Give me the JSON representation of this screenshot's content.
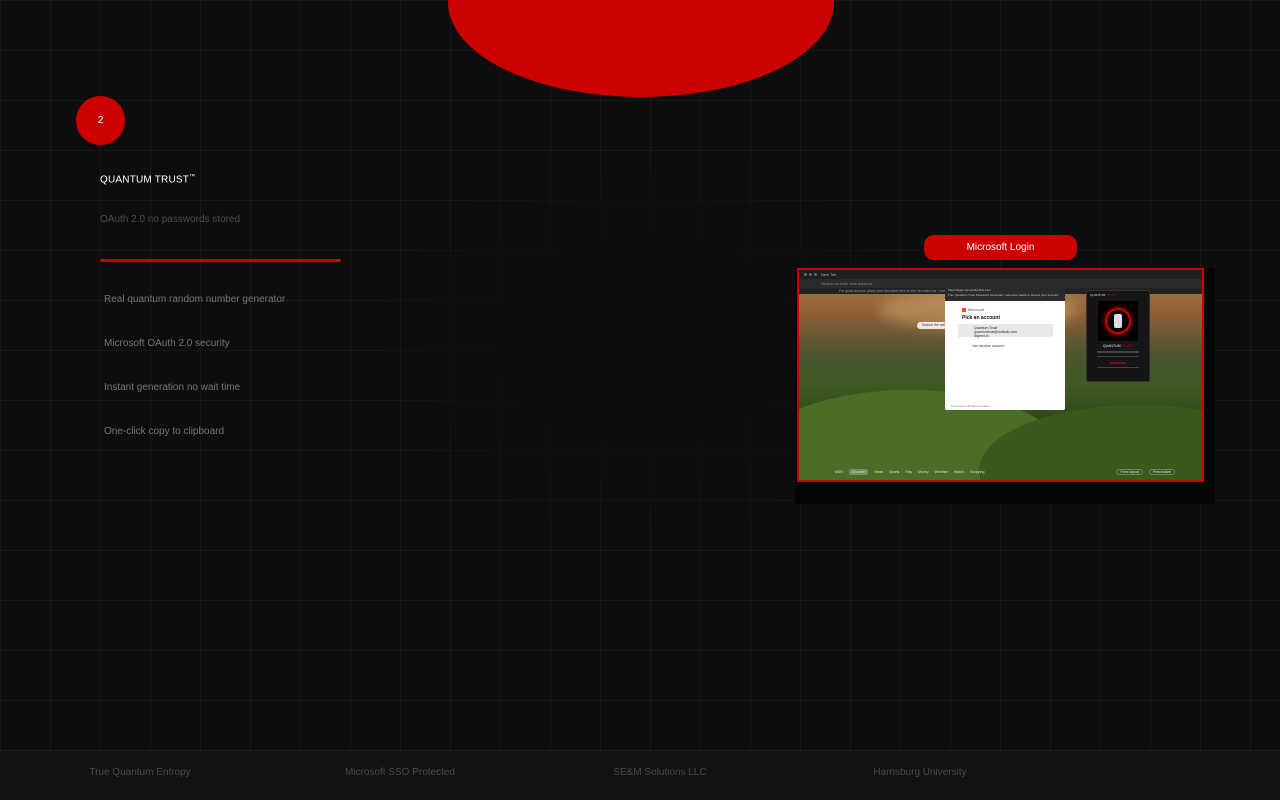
{
  "step": {
    "number": "2"
  },
  "brand": {
    "name": "QUANTUM TRUST",
    "trademark": "™"
  },
  "subtitle": "OAuth 2.0  no passwords stored",
  "features": [
    {
      "glyph": "",
      "text": "Real quantum random number generator"
    },
    {
      "glyph": "",
      "text": "Microsoft OAuth 2.0 security"
    },
    {
      "glyph": "",
      "text": "Instant generation  no wait time"
    },
    {
      "glyph": "",
      "text": "One-click copy to clipboard"
    }
  ],
  "preview": {
    "label": "Microsoft Login",
    "tab_title": "New Tab",
    "url_placeholder": "Search or enter web address",
    "favbar_text": "For quick access, place your favorites here on the favorites bar. Looking for your favorites?",
    "search_text": "Search the web",
    "popup": {
      "header_url": "https://login.microsoftonline.com",
      "header_note": "The \"Quantum Trust Password Generator\" extension wants to access your account",
      "provider": "Microsoft",
      "title": "Pick an account",
      "account_name": "Quantum Trust",
      "account_email": "quantumtrust@outlook.com",
      "account_status": "Signed in",
      "other": "Use another account",
      "terms": "Terms of use    Privacy & cookies    ..."
    },
    "extension": {
      "header_prefix": "QUANTUM",
      "header_suffix": "TRUST",
      "title_prefix": "QUANTUM",
      "title_suffix": "TRUST"
    },
    "bottom_nav": [
      "MSN",
      "Discover",
      "News",
      "Sports",
      "Play",
      "Money",
      "Weather",
      "Watch",
      "Shopping"
    ],
    "bottom_buttons": [
      "Feed layout",
      "Personalize"
    ]
  },
  "footer": [
    "True Quantum Entropy",
    "Microsoft SSO Protected",
    "SE&M Solutions LLC",
    "Harrisburg University"
  ],
  "colors": {
    "accent": "#cc0000",
    "background": "#0d0d0d",
    "muted_text": "#767676"
  }
}
